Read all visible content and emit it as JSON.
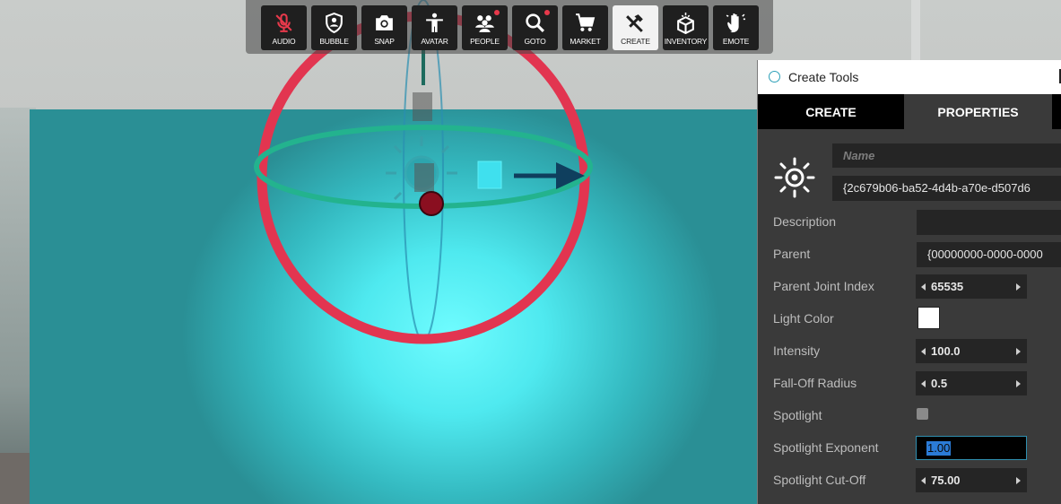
{
  "toolbar": {
    "buttons": [
      {
        "label": "AUDIO",
        "icon": "muted-mic-icon",
        "active": false
      },
      {
        "label": "BUBBLE",
        "icon": "shield-person-icon",
        "active": false
      },
      {
        "label": "SNAP",
        "icon": "camera-icon",
        "active": false
      },
      {
        "label": "AVATAR",
        "icon": "person-icon",
        "active": false
      },
      {
        "label": "PEOPLE",
        "icon": "people-icon",
        "active": false,
        "badge": true
      },
      {
        "label": "GOTO",
        "icon": "magnifier-icon",
        "active": false,
        "badge": true
      },
      {
        "label": "MARKET",
        "icon": "cart-icon",
        "active": false
      },
      {
        "label": "CREATE",
        "icon": "tools-icon",
        "active": true
      },
      {
        "label": "INVENTORY",
        "icon": "box-icon",
        "active": false
      },
      {
        "label": "EMOTE",
        "icon": "hand-wave-icon",
        "active": false
      }
    ]
  },
  "panel": {
    "title": "Create Tools",
    "tabs": [
      "CREATE",
      "PROPERTIES"
    ],
    "selected_tab": "PROPERTIES",
    "entity_icon": "light-bulb-sun-icon",
    "name_placeholder": "Name",
    "entity_id": "{2c679b06-ba52-4d4b-a70e-d507d6",
    "properties": {
      "description": {
        "label": "Description",
        "value": ""
      },
      "parent": {
        "label": "Parent",
        "value": "{00000000-0000-0000"
      },
      "parent_joint_index": {
        "label": "Parent Joint Index",
        "value": "65535"
      },
      "light_color": {
        "label": "Light Color",
        "value": "#ffffff"
      },
      "intensity": {
        "label": "Intensity",
        "value": "100.0"
      },
      "falloff_radius": {
        "label": "Fall-Off Radius",
        "value": "0.5"
      },
      "spotlight": {
        "label": "Spotlight",
        "checked": false
      },
      "spotlight_exponent": {
        "label": "Spotlight Exponent",
        "value": "1.00"
      },
      "spotlight_cutoff": {
        "label": "Spotlight Cut-Off",
        "value": "75.00"
      }
    }
  },
  "colors": {
    "gizmo_rotate_ring": "#e23550",
    "gizmo_horizontal_ring": "#23b38e",
    "gizmo_arrow": "#0f3f5e",
    "lit_box": "#4fe9ef",
    "accent_selection": "#2b7bd6"
  }
}
